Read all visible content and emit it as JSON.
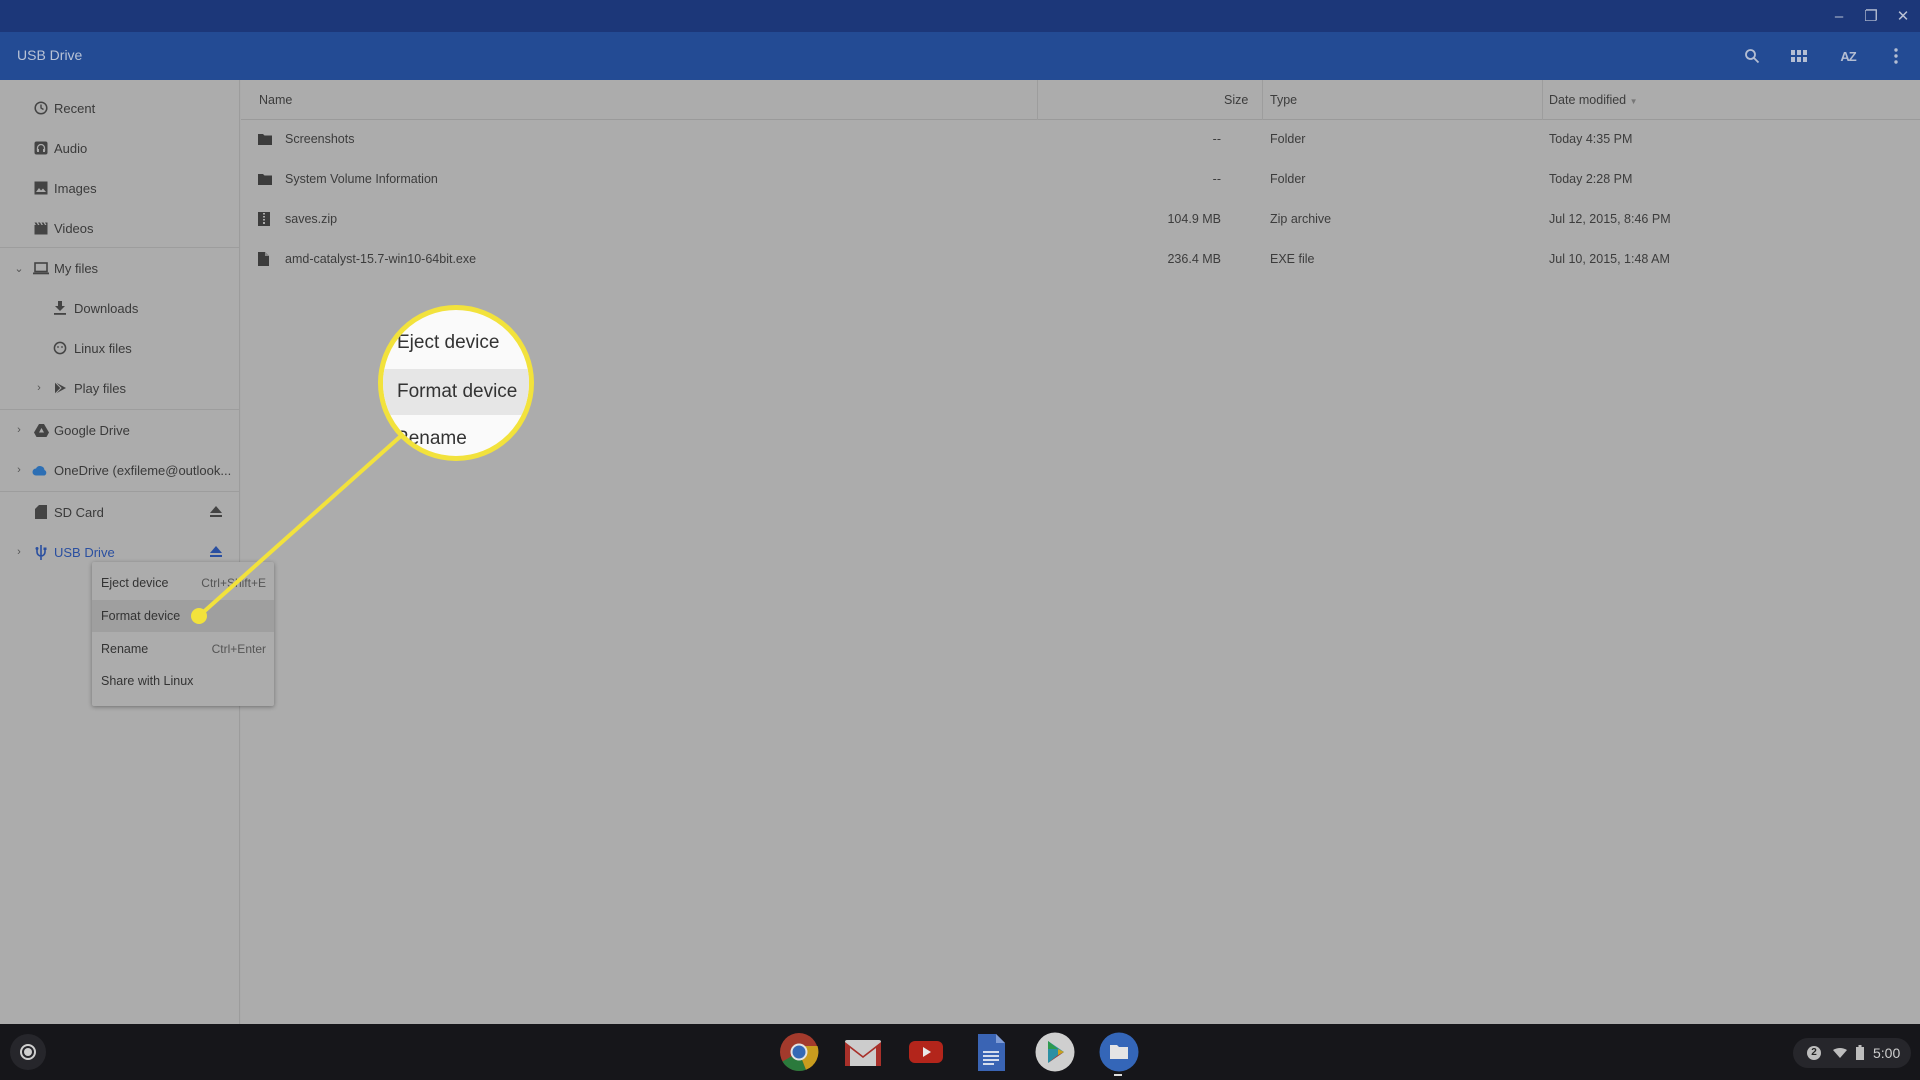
{
  "window": {
    "title": "USB Drive",
    "controls": {
      "minimize": "–",
      "maximize": "❐",
      "close": "✕"
    }
  },
  "toolbar": {
    "icons": [
      "search-icon",
      "grid-view-icon",
      "sort-az-icon",
      "more-vert-icon"
    ],
    "sort_label": "AZ"
  },
  "sidebar": {
    "items": [
      {
        "label": "Recent",
        "icon": "clock-icon"
      },
      {
        "label": "Audio",
        "icon": "headphones-icon"
      },
      {
        "label": "Images",
        "icon": "image-icon"
      },
      {
        "label": "Videos",
        "icon": "video-icon"
      },
      {
        "label": "My files",
        "icon": "laptop-icon",
        "expander": "expanded"
      },
      {
        "label": "Downloads",
        "icon": "download-icon"
      },
      {
        "label": "Linux files",
        "icon": "linux-icon"
      },
      {
        "label": "Play files",
        "icon": "play-store-icon",
        "expander": "collapsed"
      },
      {
        "label": "Google Drive",
        "icon": "google-drive-icon",
        "expander": "collapsed"
      },
      {
        "label": "OneDrive (exfileme@outlook...",
        "icon": "onedrive-icon",
        "expander": "collapsed"
      },
      {
        "label": "SD Card",
        "icon": "sd-card-icon",
        "eject": true
      },
      {
        "label": "USB Drive",
        "icon": "usb-icon",
        "expander": "collapsed",
        "eject": true,
        "selected": true
      }
    ]
  },
  "table": {
    "columns": {
      "name": "Name",
      "size": "Size",
      "type": "Type",
      "date": "Date modified"
    },
    "sort": {
      "column": "Date modified",
      "direction": "descending"
    },
    "rows": [
      {
        "name": "Screenshots",
        "size": "--",
        "type": "Folder",
        "date": "Today 4:35 PM",
        "icon": "folder-icon"
      },
      {
        "name": "System Volume Information",
        "size": "--",
        "type": "Folder",
        "date": "Today 2:28 PM",
        "icon": "folder-icon"
      },
      {
        "name": "saves.zip",
        "size": "104.9 MB",
        "type": "Zip archive",
        "date": "Jul 12, 2015, 8:46 PM",
        "icon": "zip-file-icon"
      },
      {
        "name": "amd-catalyst-15.7-win10-64bit.exe",
        "size": "236.4 MB",
        "type": "EXE file",
        "date": "Jul 10, 2015, 1:48 AM",
        "icon": "file-icon"
      }
    ]
  },
  "context_menu": {
    "items": [
      {
        "label": "Eject device",
        "shortcut": "Ctrl+Shift+E"
      },
      {
        "label": "Format device",
        "shortcut": "",
        "highlighted": true
      },
      {
        "label": "Rename",
        "shortcut": "Ctrl+Enter"
      },
      {
        "label": "Share with Linux",
        "shortcut": ""
      }
    ]
  },
  "callout": {
    "items": [
      "Eject device",
      "Format device",
      "Rename"
    ],
    "highlighted": "Format device",
    "color": "#f2e23c"
  },
  "shelf": {
    "apps": [
      "Chrome",
      "Gmail",
      "YouTube",
      "Docs",
      "Play Store",
      "Files"
    ],
    "active_app": "Files",
    "notification_count": "2",
    "time": "5:00"
  }
}
